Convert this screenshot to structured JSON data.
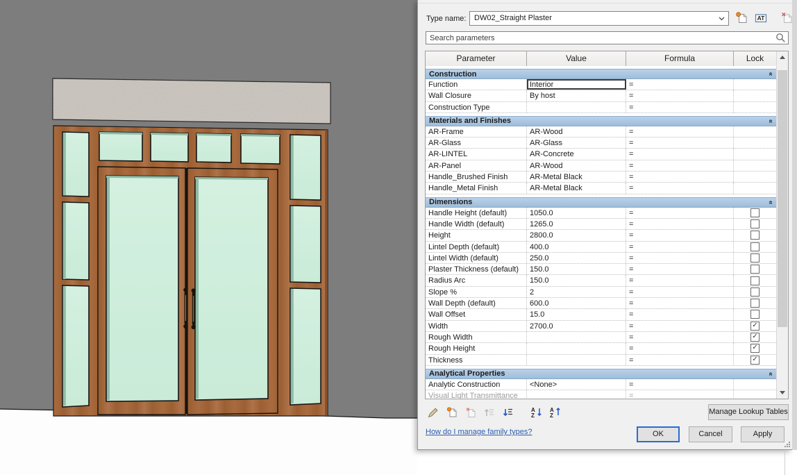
{
  "dialog": {
    "type_name": {
      "label": "Type name:",
      "value": "DW02_Straight Plaster"
    },
    "search": {
      "placeholder": "Search parameters"
    },
    "table": {
      "columns": [
        "Parameter",
        "Value",
        "Formula",
        "Lock"
      ],
      "sections": [
        {
          "title": "Construction",
          "rows": [
            {
              "param": "Function",
              "value": "Interior",
              "formula": "=",
              "selected": true
            },
            {
              "param": "Wall Closure",
              "value": "By host",
              "formula": "="
            },
            {
              "param": "Construction Type",
              "value": "",
              "formula": "="
            }
          ]
        },
        {
          "title": "Materials and Finishes",
          "rows": [
            {
              "param": "AR-Frame",
              "value": "AR-Wood",
              "formula": "="
            },
            {
              "param": "AR-Glass",
              "value": "AR-Glass",
              "formula": "="
            },
            {
              "param": "AR-LINTEL",
              "value": "AR-Concrete",
              "formula": "="
            },
            {
              "param": "AR-Panel",
              "value": "AR-Wood",
              "formula": "="
            },
            {
              "param": "Handle_Brushed Finish",
              "value": "AR-Metal Black",
              "formula": "="
            },
            {
              "param": "Handle_Metal Finish",
              "value": "AR-Metal Black",
              "formula": "="
            }
          ]
        },
        {
          "title": "Dimensions",
          "rows": [
            {
              "param": "Handle Height (default)",
              "value": "1050.0",
              "formula": "=",
              "lock": "unchecked"
            },
            {
              "param": "Handle Width (default)",
              "value": "1265.0",
              "formula": "=",
              "lock": "unchecked"
            },
            {
              "param": "Height",
              "value": "2800.0",
              "formula": "=",
              "lock": "unchecked"
            },
            {
              "param": "Lintel Depth (default)",
              "value": "400.0",
              "formula": "=",
              "lock": "unchecked"
            },
            {
              "param": "Lintel Width (default)",
              "value": "250.0",
              "formula": "=",
              "lock": "unchecked"
            },
            {
              "param": "Plaster Thickness (default)",
              "value": "150.0",
              "formula": "=",
              "lock": "unchecked"
            },
            {
              "param": "Radius Arc",
              "value": "150.0",
              "formula": "=",
              "lock": "unchecked"
            },
            {
              "param": "Slope %",
              "value": "2",
              "formula": "=",
              "lock": "unchecked"
            },
            {
              "param": "Wall Depth (default)",
              "value": "600.0",
              "formula": "=",
              "lock": "unchecked"
            },
            {
              "param": "Wall Offset",
              "value": "15.0",
              "formula": "=",
              "lock": "unchecked"
            },
            {
              "param": "Width",
              "value": "2700.0",
              "formula": "=",
              "lock": "checked"
            },
            {
              "param": "Rough Width",
              "value": "",
              "formula": "=",
              "lock": "checked"
            },
            {
              "param": "Rough Height",
              "value": "",
              "formula": "=",
              "lock": "checked"
            },
            {
              "param": "Thickness",
              "value": "",
              "formula": "=",
              "lock": "checked"
            }
          ]
        },
        {
          "title": "Analytical Properties",
          "rows": [
            {
              "param": "Analytic Construction",
              "value": "<None>",
              "formula": "="
            },
            {
              "param": "Visual Light Transmittance",
              "value": "",
              "formula": "=",
              "disabled": true
            }
          ]
        }
      ]
    },
    "buttons": {
      "manage_lookup": "Manage Lookup Tables",
      "ok": "OK",
      "cancel": "Cancel",
      "apply": "Apply"
    },
    "help_link": "How do I manage family types?",
    "icons": {
      "new-type-icon": "page with orange badge",
      "rename-type-icon": "AT boxed letters",
      "delete-type-icon": "page with red x (disabled)",
      "search-icon": "magnifier",
      "edit-parameter-icon": "pencil",
      "new-parameter-icon": "page with orange badge",
      "delete-parameter-icon": "page with red x (disabled)",
      "move-parameter-up-icon": "up arrow with lines (disabled)",
      "move-parameter-down-icon": "down arrow with lines",
      "sort-ascending-icon": "AZ with down arrow",
      "sort-descending-icon": "AZ with up arrow",
      "collapse-chevron-icon": "double chevron up"
    },
    "colors": {
      "section_header": "#a9c5e1",
      "focus_border": "#2a6bd0",
      "link": "#2a5db0"
    }
  },
  "canvas": {
    "colors": {
      "wall": "#7d7d7d",
      "floor": "#fdfdfd",
      "glass": "#cfeedd",
      "wood": "#a5673a",
      "lintel": "#d2ccc6",
      "handle": "#17140c"
    }
  }
}
